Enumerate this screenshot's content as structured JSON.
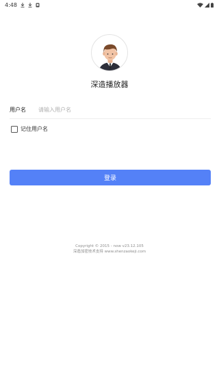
{
  "status_bar": {
    "time": "4:48",
    "left_icons": [
      "download-icon",
      "download-icon",
      "notification-icon"
    ],
    "right_icons": [
      "wifi-icon",
      "signal-icon",
      "battery-icon"
    ]
  },
  "app": {
    "title": "深造播放器"
  },
  "form": {
    "username_label": "用户名",
    "username_placeholder": "请输入用户名",
    "username_value": "",
    "remember_label": "记住用户名",
    "remember_checked": false
  },
  "login": {
    "label": "登录",
    "color": "#5481f7"
  },
  "footer": {
    "copyright": "Copyright © 2015 - now v23.12.105",
    "support": "深造加密技术支持 www.shenzaokeji.com"
  }
}
